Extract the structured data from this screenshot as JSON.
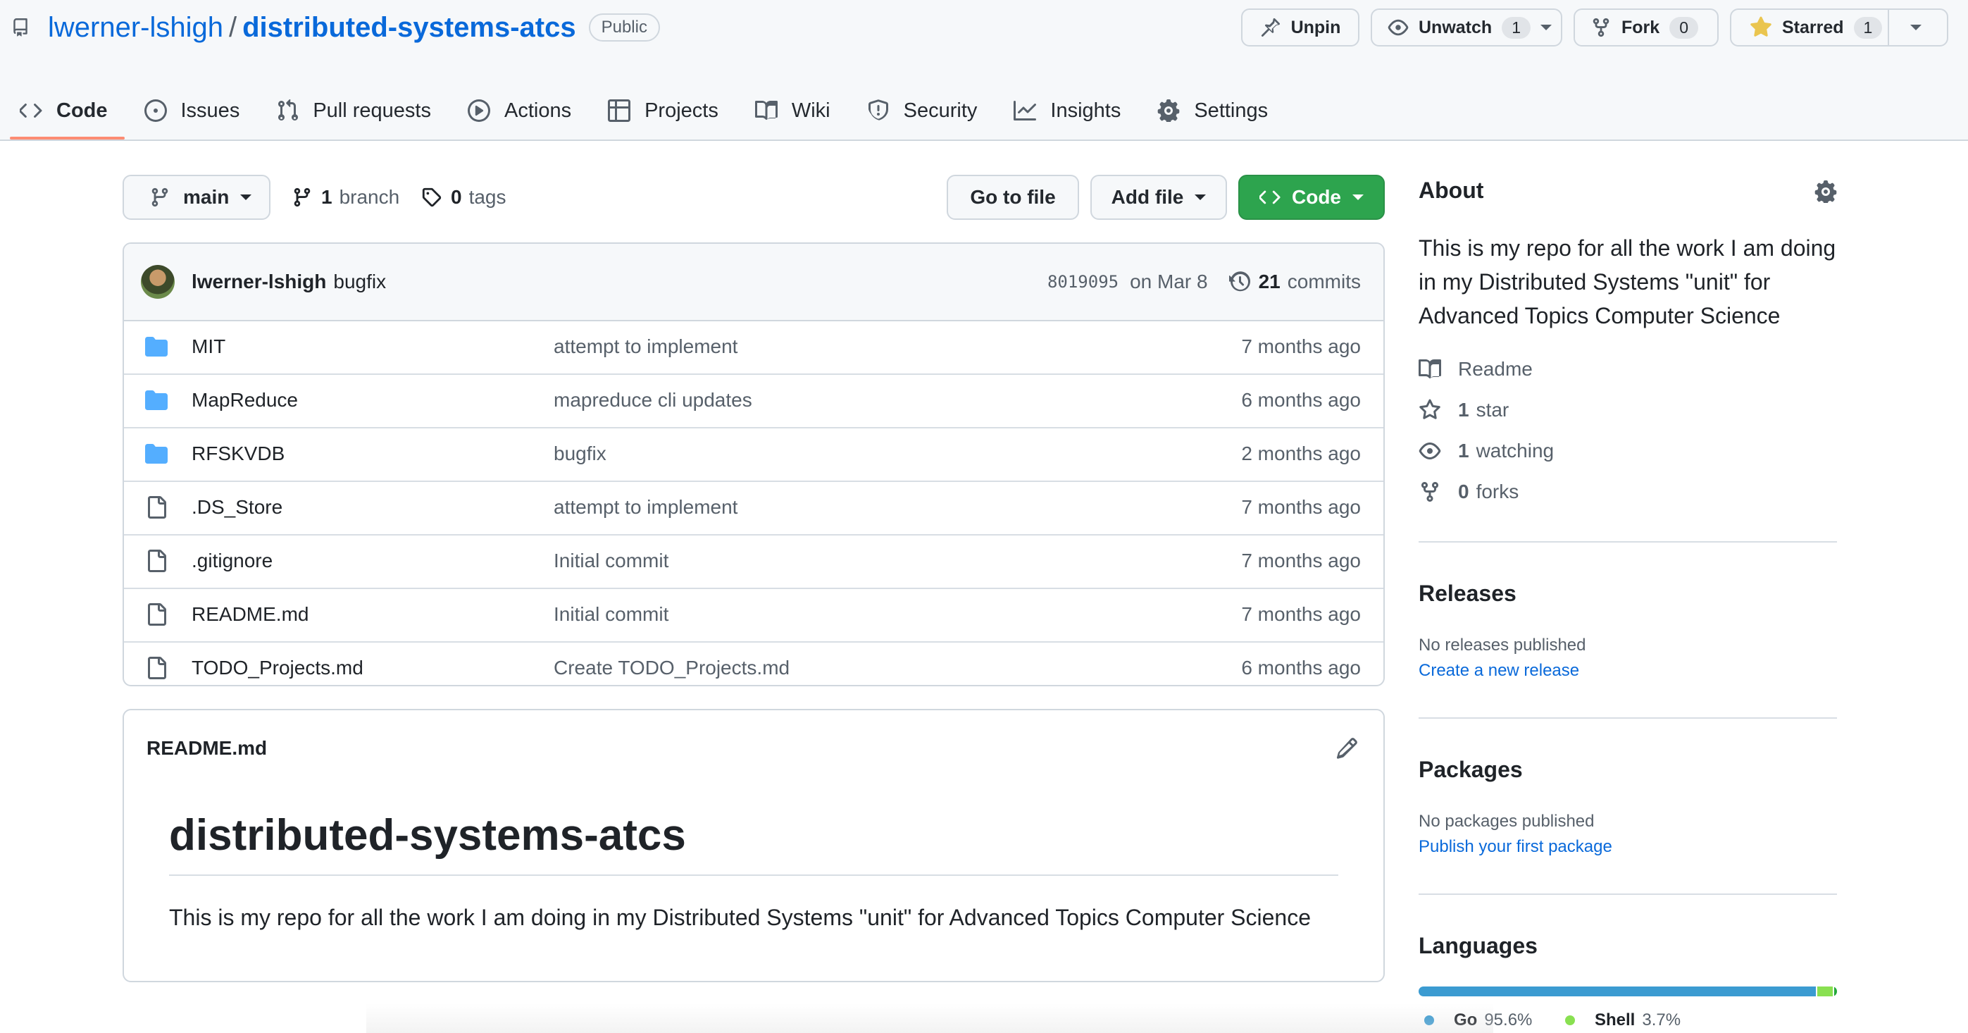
{
  "repo": {
    "owner": "lwerner-lshigh",
    "separator": "/",
    "name": "distributed-systems-atcs",
    "visibility": "Public"
  },
  "header_actions": {
    "unpin": "Unpin",
    "unwatch": "Unwatch",
    "watch_count": "1",
    "fork": "Fork",
    "fork_count": "0",
    "starred": "Starred",
    "star_count": "1"
  },
  "tabs": [
    {
      "label": "Code",
      "icon": "code-icon",
      "active": true
    },
    {
      "label": "Issues",
      "icon": "issue-icon"
    },
    {
      "label": "Pull requests",
      "icon": "pull-request-icon"
    },
    {
      "label": "Actions",
      "icon": "play-icon"
    },
    {
      "label": "Projects",
      "icon": "table-icon"
    },
    {
      "label": "Wiki",
      "icon": "book-icon"
    },
    {
      "label": "Security",
      "icon": "shield-icon"
    },
    {
      "label": "Insights",
      "icon": "graph-icon"
    },
    {
      "label": "Settings",
      "icon": "gear-icon"
    }
  ],
  "file_nav": {
    "branch": "main",
    "branch_count": "1",
    "branch_word": "branch",
    "tag_count": "0",
    "tag_word": "tags",
    "go_to_file": "Go to file",
    "add_file": "Add file",
    "code": "Code"
  },
  "latest_commit": {
    "author": "lwerner-lshigh",
    "message": "bugfix",
    "sha": "8019095",
    "date": "on Mar 8",
    "commit_count": "21",
    "commit_word": "commits"
  },
  "files": [
    {
      "name": "MIT",
      "type": "dir",
      "message": "attempt to implement",
      "age": "7 months ago"
    },
    {
      "name": "MapReduce",
      "type": "dir",
      "message": "mapreduce cli updates",
      "age": "6 months ago"
    },
    {
      "name": "RFSKVDB",
      "type": "dir",
      "message": "bugfix",
      "age": "2 months ago"
    },
    {
      "name": ".DS_Store",
      "type": "file",
      "message": "attempt to implement",
      "age": "7 months ago"
    },
    {
      "name": ".gitignore",
      "type": "file",
      "message": "Initial commit",
      "age": "7 months ago"
    },
    {
      "name": "README.md",
      "type": "file",
      "message": "Initial commit",
      "age": "7 months ago"
    },
    {
      "name": "TODO_Projects.md",
      "type": "file",
      "message": "Create TODO_Projects.md",
      "age": "6 months ago"
    }
  ],
  "readme": {
    "filename": "README.md",
    "heading": "distributed-systems-atcs",
    "body": "This is my repo for all the work I am doing in my Distributed Systems \"unit\" for Advanced Topics Computer Science"
  },
  "about": {
    "title": "About",
    "description": "This is my repo for all the work I am doing in my Distributed Systems \"unit\" for Advanced Topics Computer Science",
    "readme": "Readme",
    "stars_count": "1",
    "stars_word": "star",
    "watching_count": "1",
    "watching_word": "watching",
    "forks_count": "0",
    "forks_word": "forks"
  },
  "releases": {
    "title": "Releases",
    "empty": "No releases published",
    "link": "Create a new release"
  },
  "packages": {
    "title": "Packages",
    "empty": "No packages published",
    "link": "Publish your first package"
  },
  "languages": {
    "title": "Languages",
    "items": [
      {
        "name": "Go",
        "percent": "95.6%",
        "value": 95.6,
        "color": "#3b9bd1"
      },
      {
        "name": "Shell",
        "percent": "3.7%",
        "value": 3.7,
        "color": "#89e051"
      }
    ],
    "other_value": 0.7,
    "other_color": "#23a83a"
  },
  "colors": {
    "link": "#0969da",
    "green_button": "#2da44e",
    "active_tab_underline": "#fd8c73",
    "star": "#eac54f",
    "folder": "#54aeff"
  }
}
